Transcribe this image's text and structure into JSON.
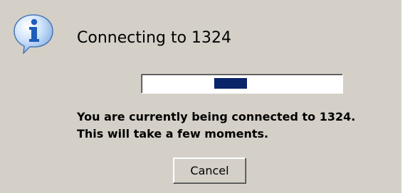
{
  "dialog": {
    "icon": "info-icon",
    "title": "Connecting to 1324",
    "progress": {
      "style": "marquee",
      "chunk_position_percent": 36,
      "chunk_color": "#0a246a"
    },
    "message_line1": "You are currently being connected to 1324.",
    "message_line2": "This will take a few moments.",
    "cancel_label": "Cancel"
  },
  "colors": {
    "dialog_background": "#d4d0c8",
    "progress_chunk": "#0a246a",
    "icon_blue": "#2b6fc9"
  }
}
